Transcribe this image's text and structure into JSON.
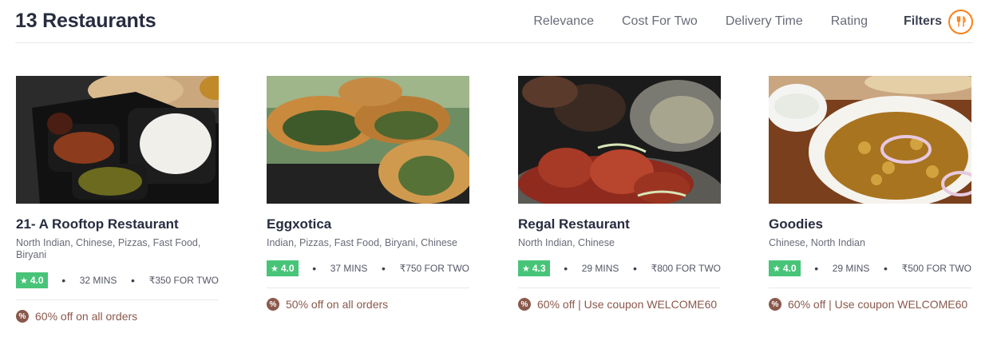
{
  "header": {
    "title": "13 Restaurants",
    "sort_options": [
      "Relevance",
      "Cost For Two",
      "Delivery Time",
      "Rating"
    ],
    "filters_label": "Filters",
    "filters_icon": "filter-utensils-icon",
    "accent_color": "#fc8019"
  },
  "restaurants": [
    {
      "name": "21- A Rooftop Restaurant",
      "cuisines": "North Indian, Chinese, Pizzas, Fast Food, Biryani",
      "rating": "4.0",
      "delivery_time": "32 MINS",
      "cost_for_two": "₹350 FOR TWO",
      "offer": "60% off on all orders"
    },
    {
      "name": "Eggxotica",
      "cuisines": "Indian, Pizzas, Fast Food, Biryani, Chinese",
      "rating": "4.0",
      "delivery_time": "37 MINS",
      "cost_for_two": "₹750 FOR TWO",
      "offer": "50% off on all orders"
    },
    {
      "name": "Regal Restaurant",
      "cuisines": "North Indian, Chinese",
      "rating": "4.3",
      "delivery_time": "29 MINS",
      "cost_for_two": "₹800 FOR TWO",
      "offer": "60% off | Use coupon WELCOME60"
    },
    {
      "name": "Goodies",
      "cuisines": "Chinese, North Indian",
      "rating": "4.0",
      "delivery_time": "29 MINS",
      "cost_for_two": "₹500 FOR TWO",
      "offer": "60% off | Use coupon WELCOME60"
    }
  ],
  "colors": {
    "rating_badge": "#48c479",
    "offer_text": "#8a584b"
  }
}
